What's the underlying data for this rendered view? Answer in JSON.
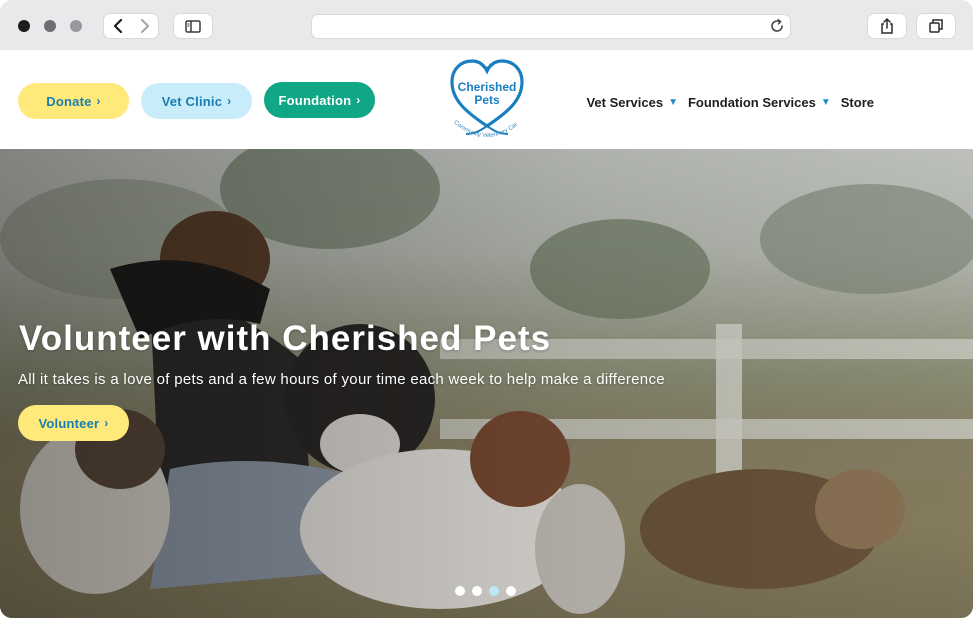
{
  "browser": {
    "address": "",
    "icons": [
      "close-dot",
      "minimize-dot",
      "zoom-dot",
      "back-chevron-icon",
      "forward-chevron-icon",
      "sidebar-icon",
      "reload-icon",
      "share-icon",
      "tabs-icon"
    ]
  },
  "header": {
    "buttons": [
      {
        "label": "Donate",
        "chevron": "›"
      },
      {
        "label": "Vet Clinic",
        "chevron": "›"
      },
      {
        "label": "Foundation",
        "chevron": "›"
      }
    ],
    "logo": {
      "line1": "Cherished",
      "line2": "Pets",
      "tagline": "Community Veterinary Care"
    },
    "nav": [
      {
        "label": "Vet Services",
        "has_dropdown": true
      },
      {
        "label": "Foundation Services",
        "has_dropdown": true
      },
      {
        "label": "Store",
        "has_dropdown": false
      }
    ]
  },
  "hero": {
    "title": "Volunteer with Cherished Pets",
    "subtitle": "All it takes is a love of pets and a few hours of your time each week to help make a difference",
    "cta": {
      "label": "Volunteer",
      "chevron": "›"
    },
    "carousel": {
      "slides": 4,
      "active_index": 2
    }
  },
  "colors": {
    "yellow_pill": "#ffe97a",
    "light_blue_pill": "#c9ecfb",
    "green_pill": "#0fa785",
    "link_blue": "#1a7fb0",
    "logo_blue": "#1a7fc0"
  }
}
